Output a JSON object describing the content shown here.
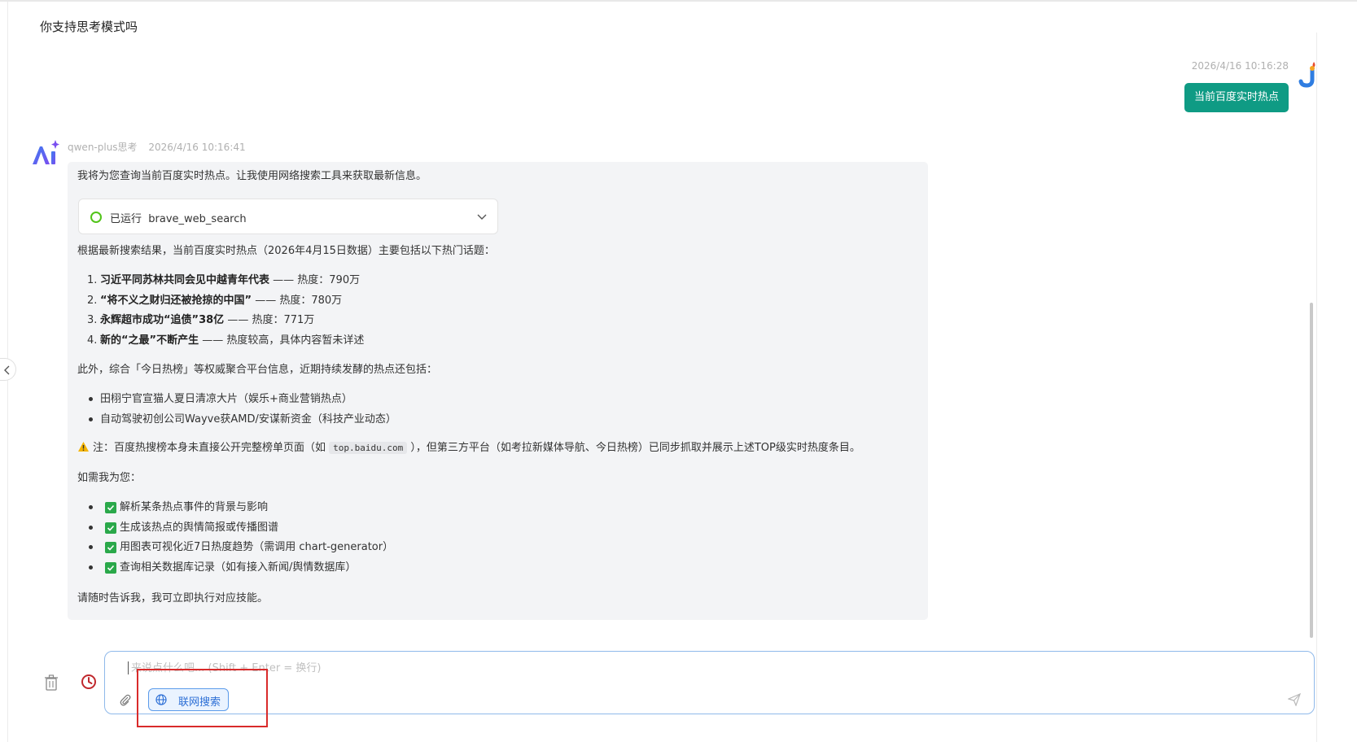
{
  "previous_message": "你支持思考模式吗",
  "user_message": {
    "time": "2026/4/16 10:16:28",
    "text": "当前百度实时热点"
  },
  "ai_message": {
    "model": "qwen-plus思考",
    "time": "2026/4/16 10:16:41",
    "intro": "我将为您查询当前百度实时热点。让我使用网络搜索工具来获取最新信息。",
    "tool": {
      "status": "已运行",
      "name": "brave_web_search",
      "status_color": "#52c41a"
    },
    "summary": "根据最新搜索结果，当前百度实时热点（2026年4月15日数据）主要包括以下热门话题：",
    "hot_list": [
      {
        "num": "1.",
        "title": "习近平同苏林共同会见中越青年代表",
        "rest": " —— 热度：790万"
      },
      {
        "num": "2.",
        "title": "“将不义之财归还被抢掠的中国”",
        "rest": " —— 热度：780万"
      },
      {
        "num": "3.",
        "title": "永辉超市成功“追债”38亿",
        "rest": " —— 热度：771万"
      },
      {
        "num": "4.",
        "title": "新的“之最”不断产生",
        "rest": " —— 热度较高，具体内容暂未详述"
      }
    ],
    "extra_intro": "此外，综合「今日热榜」等权威聚合平台信息，近期持续发酵的热点还包括：",
    "extra_list": [
      "田栩宁官宣猫人夏日清凉大片（娱乐+商业营销热点）",
      "自动驾驶初创公司Wayve获AMD/安谋新资金（科技产业动态）"
    ],
    "note_prefix": "注：百度热搜榜本身未直接公开完整榜单页面（如 ",
    "note_code": "top.baidu.com",
    "note_suffix": " ），但第三方平台（如考拉新媒体导航、今日热榜）已同步抓取并展示上述TOP级实时热度条目。",
    "offer_intro": "如需我为您：",
    "offers": [
      "解析某条热点事件的背景与影响",
      "生成该热点的舆情简报或传播图谱",
      "用图表可视化近7日热度趋势（需调用 chart-generator）",
      "查询相关数据库记录（如有接入新闻/舆情数据库）"
    ],
    "closing": "请随时告诉我，我可立即执行对应技能。"
  },
  "composer": {
    "placeholder": "来说点什么吧... (Shift + Enter = 换行)",
    "web_search_label": "联网搜索"
  },
  "colors": {
    "accent": "#0f9b84",
    "web_search": "#2d6fd6",
    "highlight": "#d92b2b",
    "check": "#2aa84a"
  }
}
